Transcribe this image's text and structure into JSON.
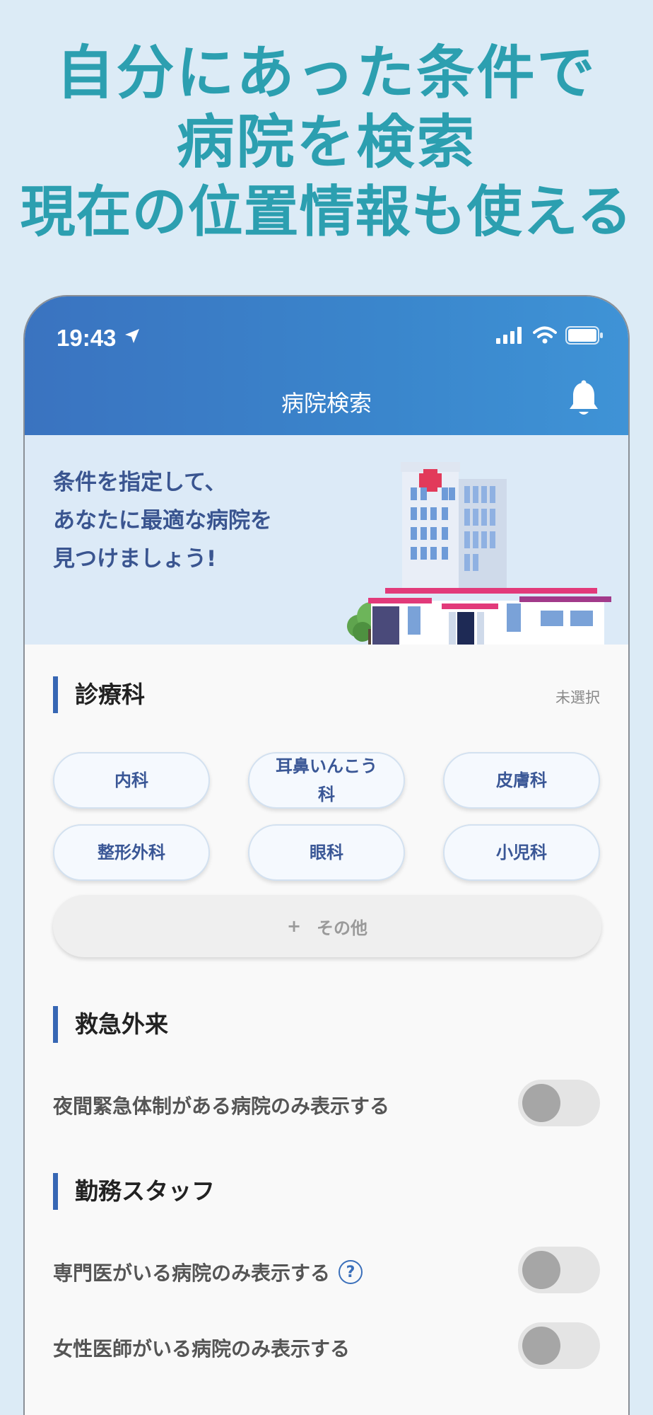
{
  "headline": {
    "line1": "自分にあった条件で",
    "line2": "病院を検索",
    "line3": "現在の位置情報も使える"
  },
  "status_bar": {
    "time": "19:43"
  },
  "nav": {
    "title": "病院検索",
    "bell_icon": "bell-icon"
  },
  "banner": {
    "line1": "条件を指定して、",
    "line2": "あなたに最適な病院を",
    "line3": "見つけましょう!"
  },
  "departments": {
    "title": "診療科",
    "status": "未選択",
    "chips": [
      "内科",
      "耳鼻いんこう科",
      "皮膚科",
      "整形外科",
      "眼科",
      "小児科"
    ],
    "more_plus": "+",
    "more_label": "その他"
  },
  "emergency": {
    "title": "救急外来",
    "night_label": "夜間緊急体制がある病院のみ表示する"
  },
  "staff": {
    "title": "勤務スタッフ",
    "specialist_label": "専門医がいる病院のみ表示する",
    "help_mark": "?",
    "female_label": "女性医師がいる病院のみ表示する"
  },
  "toggles": {
    "night": false,
    "specialist": false,
    "female": false
  },
  "colors": {
    "accent": "#3767b4",
    "header": "#3a7fc8",
    "headline": "#2c9fb0"
  }
}
